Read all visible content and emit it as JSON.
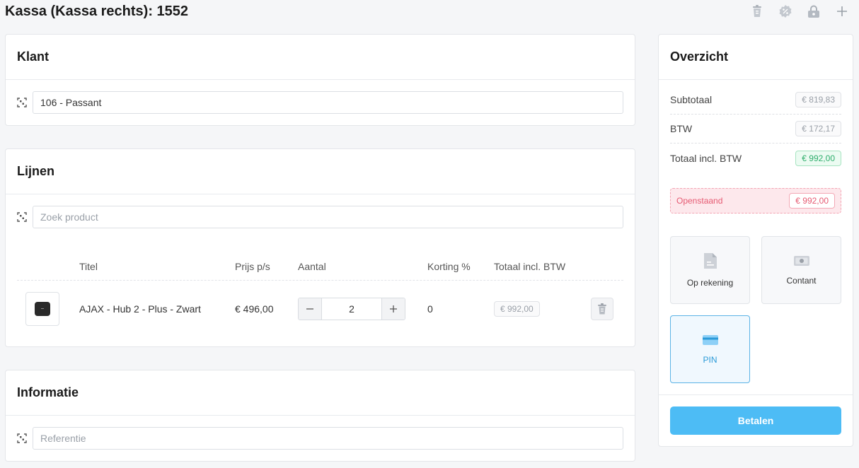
{
  "page": {
    "title": "Kassa (Kassa rechts): 1552"
  },
  "top_actions": [
    {
      "icon": "trash-icon"
    },
    {
      "icon": "discount-icon"
    },
    {
      "icon": "lock-icon"
    },
    {
      "icon": "plus-icon"
    }
  ],
  "klant": {
    "heading": "Klant",
    "customer_value": "106 - Passant"
  },
  "lijnen": {
    "heading": "Lijnen",
    "search_placeholder": "Zoek product",
    "columns": {
      "titel": "Titel",
      "prijs": "Prijs p/s",
      "aantal": "Aantal",
      "korting": "Korting %",
      "totaal": "Totaal incl. BTW"
    },
    "rows": [
      {
        "title": "AJAX - Hub 2 - Plus - Zwart",
        "price": "€ 496,00",
        "quantity": "2",
        "discount": "0",
        "total": "€ 992,00"
      }
    ]
  },
  "informatie": {
    "heading": "Informatie",
    "reference_placeholder": "Referentie"
  },
  "overzicht": {
    "heading": "Overzicht",
    "subtotal_label": "Subtotaal",
    "subtotal_value": "€ 819,83",
    "btw_label": "BTW",
    "btw_value": "€ 172,17",
    "total_label": "Totaal incl. BTW",
    "total_value": "€ 992,00",
    "open_label": "Openstaand",
    "open_value": "€ 992,00",
    "payment_methods": [
      {
        "label": "Op rekening",
        "icon": "invoice-icon",
        "selected": false
      },
      {
        "label": "Contant",
        "icon": "cash-icon",
        "selected": false
      },
      {
        "label": "PIN",
        "icon": "card-icon",
        "selected": true
      }
    ],
    "pay_button": "Betalen"
  },
  "colors": {
    "accent": "#4dbcf5",
    "positive": "#2fae6c",
    "outstanding": "#e65a72"
  }
}
